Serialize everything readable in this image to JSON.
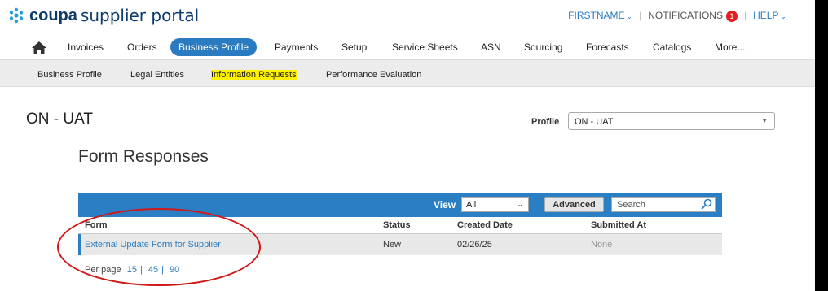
{
  "header": {
    "brand_bold": "coupa",
    "brand_rest": "supplier portal",
    "user": "FIRSTNAME",
    "notifications_label": "NOTIFICATIONS",
    "notifications_count": "1",
    "help": "HELP"
  },
  "nav": {
    "items": [
      "Invoices",
      "Orders",
      "Business Profile",
      "Payments",
      "Setup",
      "Service Sheets",
      "ASN",
      "Sourcing",
      "Forecasts",
      "Catalogs",
      "More..."
    ],
    "active": "Business Profile"
  },
  "subnav": {
    "items": [
      "Business Profile",
      "Legal Entities",
      "Information Requests",
      "Performance Evaluation"
    ],
    "highlighted": "Information Requests"
  },
  "page": {
    "title": "ON - UAT",
    "profile_label": "Profile",
    "profile_value": "ON - UAT",
    "section_title": "Form Responses"
  },
  "table": {
    "view_label": "View",
    "view_value": "All",
    "advanced_label": "Advanced",
    "search_placeholder": "Search",
    "columns": [
      "Form",
      "Status",
      "Created Date",
      "Submitted At"
    ],
    "rows": [
      {
        "form": "External Update Form for Supplier",
        "status": "New",
        "created": "02/26/25",
        "submitted": "None"
      }
    ],
    "per_page_label": "Per page",
    "per_page_options": [
      "15",
      "45",
      "90"
    ]
  },
  "colors": {
    "accent": "#2a7fc4",
    "highlight": "#fff200",
    "annotation": "#d01818"
  }
}
